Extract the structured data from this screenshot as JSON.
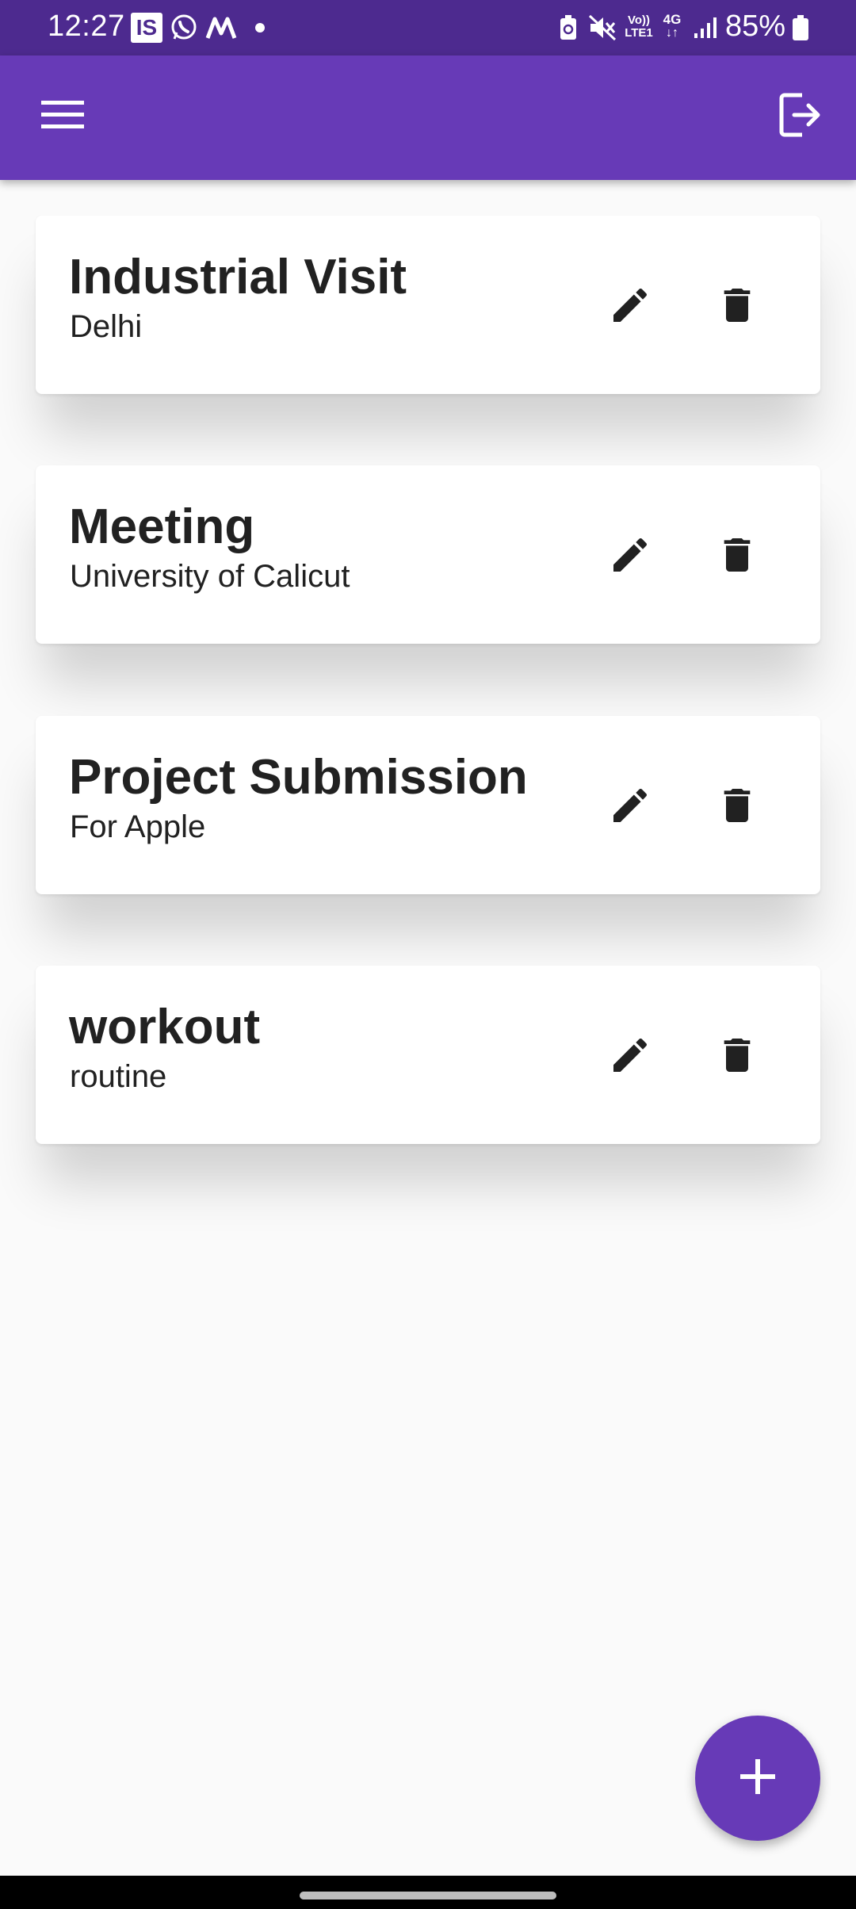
{
  "status_bar": {
    "time": "12:27",
    "notification_icons": [
      "is-app-icon",
      "whatsapp-icon",
      "m-app-icon",
      "dot-icon"
    ],
    "is_label": "IS",
    "volte_label_top": "Vo))",
    "volte_label_bottom": "LTE1",
    "network_label": "4G",
    "battery_percent": "85%"
  },
  "app_bar": {
    "background_color": "#673ab7",
    "menu_icon": "hamburger-menu-icon",
    "logout_icon": "logout-icon"
  },
  "items": [
    {
      "title": "Industrial Visit",
      "subtitle": "Delhi"
    },
    {
      "title": "Meeting",
      "subtitle": "University of Calicut"
    },
    {
      "title": "Project Submission",
      "subtitle": "For Apple"
    },
    {
      "title": "workout",
      "subtitle": "routine"
    }
  ],
  "item_actions": {
    "edit_icon": "pencil-icon",
    "delete_icon": "trash-icon"
  },
  "fab": {
    "icon": "plus-icon",
    "color": "#673ab7"
  }
}
